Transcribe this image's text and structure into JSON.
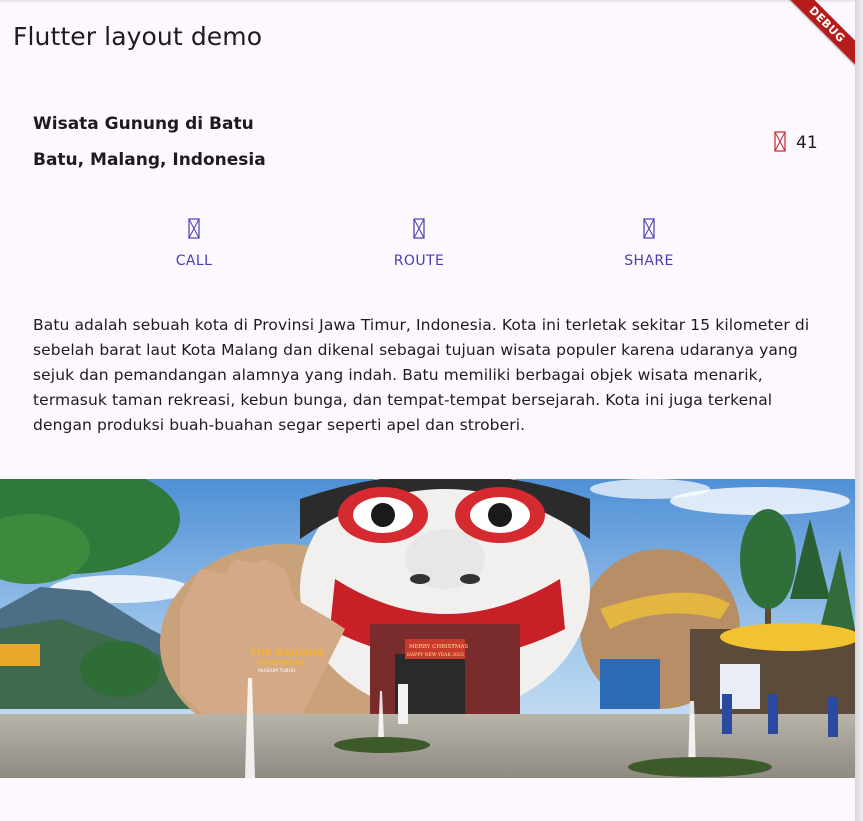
{
  "app": {
    "title": "Flutter layout demo",
    "debug_banner": "DEBUG"
  },
  "title_section": {
    "name": "Wisata Gunung di Batu",
    "location": "Batu, Malang, Indonesia",
    "star_icon": "missing-glyph-icon",
    "star_count": "41"
  },
  "buttons": [
    {
      "label": "CALL",
      "icon": "missing-glyph-icon"
    },
    {
      "label": "ROUTE",
      "icon": "missing-glyph-icon"
    },
    {
      "label": "SHARE",
      "icon": "missing-glyph-icon"
    }
  ],
  "description": "Batu adalah sebuah kota di Provinsi Jawa Timur, Indonesia. Kota ini terletak sekitar 15 kilometer di sebelah barat laut Kota Malang dan dikenal sebagai tujuan wisata populer karena udaranya yang sejuk dan pemandangan alamnya yang indah. Batu memiliki berbagai objek wisata menarik, termasuk taman rekreasi, kebun bunga, dan tempat-tempat bersejarah. Kota ini juga terkenal dengan produksi buah-buahan segar seperti apel dan stroberi.",
  "image": {
    "sign_line1": "THE BAGONG",
    "sign_line2": "ADVENTURE",
    "sign_line3": "MUSEUM TUBUH",
    "banner_line1": "MERRY CHRISTMAS",
    "banner_line2": "HAPPY NEW YEAR 2023"
  },
  "colors": {
    "background": "#fdf7ff",
    "accent": "#4a3fb0",
    "star": "#c62828",
    "debug": "#b71c1c"
  }
}
